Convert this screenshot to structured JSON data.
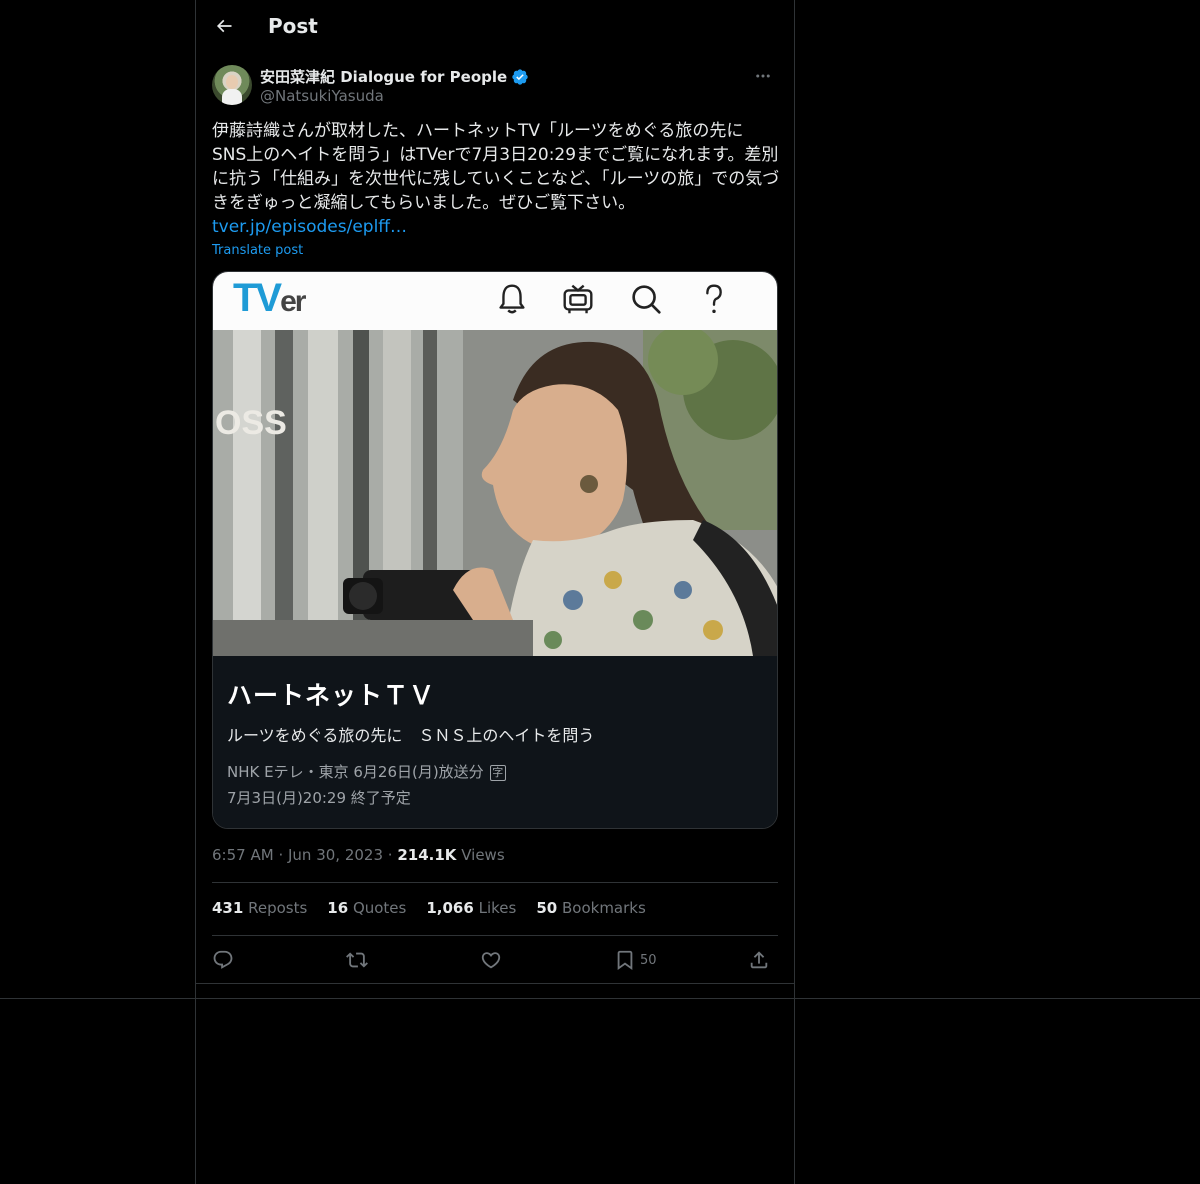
{
  "header": {
    "title": "Post"
  },
  "author": {
    "name": "安田菜津紀 Dialogue for People",
    "handle": "@NatsukiYasuda"
  },
  "post": {
    "text": "伊藤詩織さんが取材した、ハートネットTV「ルーツをめぐる旅の先に SNS上のヘイトを問う」はTVerで7月3日20:29までご覧になれます。差別に抗う「仕組み」を次世代に残していくことなど、「ルーツの旅」での気づきをぎゅっと凝縮してもらいました。ぜひご覧下さい。",
    "link": "tver.jp/episodes/eplff…",
    "translate": "Translate post"
  },
  "card": {
    "logo_main": "TV",
    "logo_suffix": "er",
    "title": "ハートネットＴＶ",
    "subtitle": "ルーツをめぐる旅の先に　ＳＮＳ上のヘイトを問う",
    "meta1": "NHK Eテレ・東京 6月26日(月)放送分",
    "badge": "字",
    "meta2": "7月3日(月)20:29 終了予定",
    "banner_icons": [
      "bell-icon",
      "tv-icon",
      "search-icon",
      "help-icon"
    ]
  },
  "meta": {
    "time": "6:57 AM",
    "sep": "·",
    "date": "Jun 30, 2023",
    "views_count": "214.1K",
    "views_label": "Views"
  },
  "stats": {
    "reposts_count": "431",
    "reposts_label": "Reposts",
    "quotes_count": "16",
    "quotes_label": "Quotes",
    "likes_count": "1,066",
    "likes_label": "Likes",
    "bookmarks_count": "50",
    "bookmarks_label": "Bookmarks"
  },
  "actions": {
    "bookmark_count": "50",
    "icons": [
      "reply-icon",
      "repost-icon",
      "like-icon",
      "bookmark-icon",
      "share-icon"
    ]
  },
  "colors": {
    "background": "#000000",
    "text": "#e7e9ea",
    "muted": "#71767b",
    "accent": "#1d9bf0",
    "border": "#2f3336",
    "card_info_bg": "#0f1419"
  }
}
